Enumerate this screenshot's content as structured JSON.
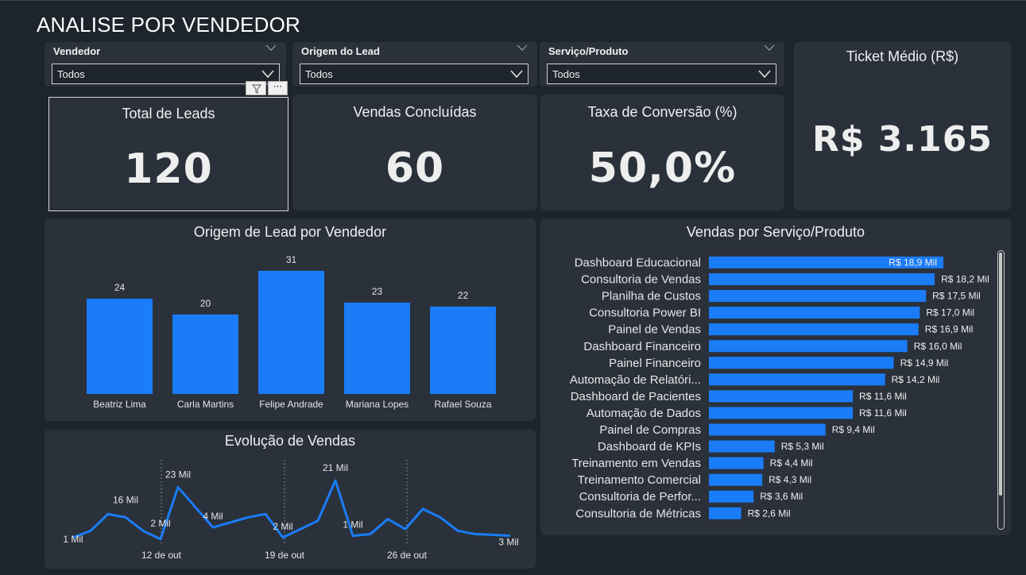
{
  "page": {
    "title": "ANALISE POR VENDEDOR"
  },
  "slicers": [
    {
      "label": "Vendedor",
      "value": "Todos"
    },
    {
      "label": "Origem do Lead",
      "value": "Todos"
    },
    {
      "label": "Serviço/Produto",
      "value": "Todos"
    }
  ],
  "kpis": {
    "total_leads": {
      "title": "Total de Leads",
      "value": "120"
    },
    "vendas": {
      "title": "Vendas Concluídas",
      "value": "60"
    },
    "taxa": {
      "title": "Taxa de Conversão (%)",
      "value": "50,0%"
    },
    "ticket": {
      "title": "Ticket Médio (R$)",
      "value": "R$ 3.165"
    }
  },
  "visual_header": {
    "more_label": "···"
  },
  "colors": {
    "bar": "#1a7cf7",
    "background": "#1e242c",
    "card": "#2a313a",
    "line": "#1a7cf7"
  },
  "chart_data": [
    {
      "type": "bar",
      "title": "Origem de Lead por Vendedor",
      "categories": [
        "Beatriz Lima",
        "Carla Martins",
        "Felipe Andrade",
        "Mariana Lopes",
        "Rafael Souza"
      ],
      "values": [
        24,
        20,
        31,
        23,
        22
      ],
      "data_labels": [
        "24",
        "20",
        "31",
        "23",
        "22"
      ],
      "ylim": [
        0,
        31
      ]
    },
    {
      "type": "bar",
      "orientation": "horizontal",
      "title": "Vendas por Serviço/Produto",
      "categories": [
        "Dashboard Educacional",
        "Consultoria de Vendas",
        "Planilha de Custos",
        "Consultoria Power BI",
        "Painel de Vendas",
        "Dashboard Financeiro",
        "Painel Financeiro",
        "Automação de Relatóri...",
        "Dashboard de Pacientes",
        "Automação de Dados",
        "Painel de Compras",
        "Dashboard de KPIs",
        "Treinamento em Vendas",
        "Treinamento Comercial",
        "Consultoria de Perfor...",
        "Consultoria de Métricas"
      ],
      "values": [
        18.9,
        18.2,
        17.5,
        17.0,
        16.9,
        16.0,
        14.9,
        14.2,
        11.6,
        11.6,
        9.4,
        5.3,
        4.4,
        4.3,
        3.6,
        2.6
      ],
      "data_labels": [
        "R$ 18,9 Mil",
        "R$ 18,2 Mil",
        "R$ 17,5 Mil",
        "R$ 17,0 Mil",
        "R$ 16,9 Mil",
        "R$ 16,0 Mil",
        "R$ 14,9 Mil",
        "R$ 14,2 Mil",
        "R$ 11,6 Mil",
        "R$ 11,6 Mil",
        "R$ 9,4 Mil",
        "R$ 5,3 Mil",
        "R$ 4,4 Mil",
        "R$ 4,3 Mil",
        "R$ 3,6 Mil",
        "R$ 2,6 Mil"
      ],
      "unit": "Mil R$"
    },
    {
      "type": "line",
      "title": "Evolução de Vendas",
      "x_ticks": [
        "12 de out",
        "19 de out",
        "26 de out"
      ],
      "values": [
        1,
        3,
        8,
        7,
        3,
        0.5,
        16,
        10,
        4,
        5.5,
        7,
        8,
        1,
        3.5,
        6,
        18,
        1.5,
        2,
        6.5,
        3.5,
        9.5,
        7,
        3,
        2,
        1.8,
        1.5
      ],
      "point_labels": [
        {
          "index": 0,
          "text": "1 Mil"
        },
        {
          "index": 3,
          "text": "16 Mil"
        },
        {
          "index": 5,
          "text": "2 Mil"
        },
        {
          "index": 6,
          "text": "23 Mil"
        },
        {
          "index": 8,
          "text": "4 Mil"
        },
        {
          "index": 12,
          "text": "2 Mil"
        },
        {
          "index": 15,
          "text": "21 Mil"
        },
        {
          "index": 16,
          "text": "1 Mil"
        },
        {
          "index": 25,
          "text": "3 Mil"
        }
      ]
    }
  ]
}
